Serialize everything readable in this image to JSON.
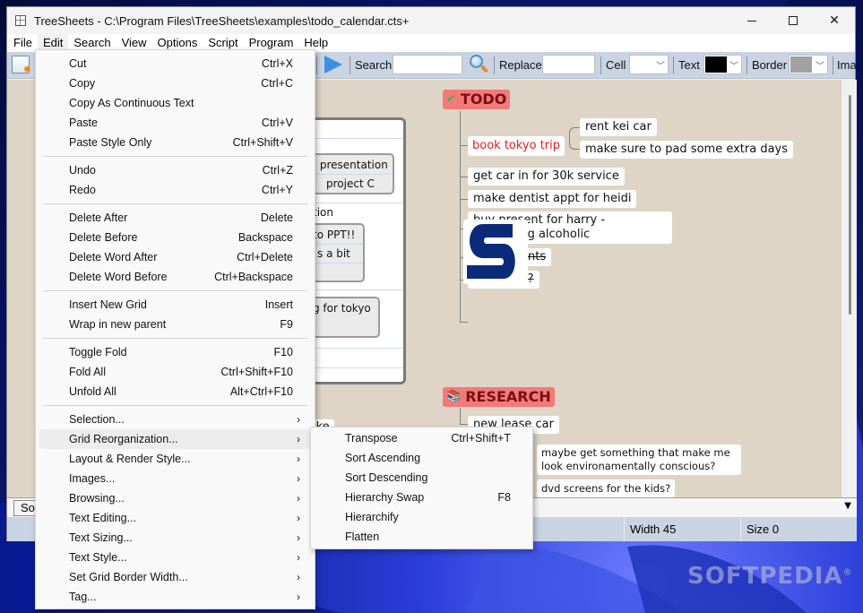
{
  "window": {
    "title": "TreeSheets - C:\\Program Files\\TreeSheets\\examples\\todo_calendar.cts+",
    "controls": {
      "minimize": "—",
      "maximize": "□",
      "close": "✕"
    }
  },
  "menubar": {
    "items": [
      "File",
      "Edit",
      "Search",
      "View",
      "Options",
      "Script",
      "Program",
      "Help"
    ],
    "active": "Edit"
  },
  "toolbar": {
    "search_label": "Search",
    "search_value": "",
    "replace_label": "Replace",
    "replace_value": "",
    "cell_label": "Cell",
    "cell_color": "#ffffff",
    "text_label": "Text",
    "text_color": "#000000",
    "border_label": "Border",
    "border_color": "#a0a0a0",
    "image_label_truncated": "Ima",
    "icons": [
      "new-document-icon",
      "play-icon",
      "magnifier-icon"
    ]
  },
  "edit_menu": {
    "groups": [
      [
        {
          "label": "Cut",
          "shortcut": "Ctrl+X"
        },
        {
          "label": "Copy",
          "shortcut": "Ctrl+C"
        },
        {
          "label": "Copy As Continuous Text",
          "shortcut": ""
        },
        {
          "label": "Paste",
          "shortcut": "Ctrl+V"
        },
        {
          "label": "Paste Style Only",
          "shortcut": "Ctrl+Shift+V"
        }
      ],
      [
        {
          "label": "Undo",
          "shortcut": "Ctrl+Z"
        },
        {
          "label": "Redo",
          "shortcut": "Ctrl+Y"
        }
      ],
      [
        {
          "label": "Delete After",
          "shortcut": "Delete"
        },
        {
          "label": "Delete Before",
          "shortcut": "Backspace"
        },
        {
          "label": "Delete Word After",
          "shortcut": "Ctrl+Delete"
        },
        {
          "label": "Delete Word Before",
          "shortcut": "Ctrl+Backspace"
        }
      ],
      [
        {
          "label": "Insert New Grid",
          "shortcut": "Insert"
        },
        {
          "label": "Wrap in new parent",
          "shortcut": "F9"
        }
      ],
      [
        {
          "label": "Toggle Fold",
          "shortcut": "F10"
        },
        {
          "label": "Fold All",
          "shortcut": "Ctrl+Shift+F10"
        },
        {
          "label": "Unfold All",
          "shortcut": "Alt+Ctrl+F10"
        }
      ],
      [
        {
          "label": "Selection...",
          "submenu": true
        },
        {
          "label": "Grid Reorganization...",
          "submenu": true,
          "highlighted": true
        },
        {
          "label": "Layout & Render Style...",
          "submenu": true
        },
        {
          "label": "Images...",
          "submenu": true
        },
        {
          "label": "Browsing...",
          "submenu": true
        },
        {
          "label": "Text Editing...",
          "submenu": true
        },
        {
          "label": "Text Sizing...",
          "submenu": true
        },
        {
          "label": "Text Style...",
          "submenu": true
        },
        {
          "label": "Set Grid Border Width...",
          "submenu": true
        },
        {
          "label": "Tag...",
          "submenu": true
        }
      ]
    ],
    "submenu_arrow": "›"
  },
  "grid_reorganization_submenu": {
    "items": [
      {
        "label": "Transpose",
        "shortcut": "Ctrl+Shift+T"
      },
      {
        "label": "Sort Ascending",
        "shortcut": ""
      },
      {
        "label": "Sort Descending",
        "shortcut": ""
      },
      {
        "label": "Hierarchy Swap",
        "shortcut": "F8"
      },
      {
        "label": "Hierarchify",
        "shortcut": ""
      },
      {
        "label": "Flatten",
        "shortcut": ""
      }
    ]
  },
  "background_grid_fragments": {
    "lines": [
      ": presentation",
      "project C",
      "tion",
      "to PPT!!",
      "s a bit",
      "g for tokyo",
      "ike"
    ]
  },
  "todo": {
    "title": "TODO",
    "icon": "checkmark-icon",
    "items": [
      {
        "text": "book tokyo trip",
        "color": "#e02020",
        "children": [
          "rent kei car",
          "make sure to pad some extra days"
        ]
      },
      {
        "text": "get car in for 30k service"
      },
      {
        "text": "make dentist appt for heidi"
      },
      {
        "text": "buy present for harry - something alcoholic"
      },
      {
        "text": "water plants",
        "done": true
      },
      {
        "text": "sell stock?",
        "done": true
      },
      {
        "image": "softpedia-s-logo"
      }
    ]
  },
  "research": {
    "title": "RESEARCH",
    "icon": "books-icon",
    "items": [
      {
        "text": "new lease car"
      },
      {
        "text": "maybe get something that make me look environamentally conscious?"
      },
      {
        "text": "dvd screens for the kids?"
      }
    ]
  },
  "tabs": {
    "current": "Sof"
  },
  "statusbar": {
    "width": "Width 45",
    "size": "Size 0"
  },
  "watermark": "SOFTPEDIA"
}
